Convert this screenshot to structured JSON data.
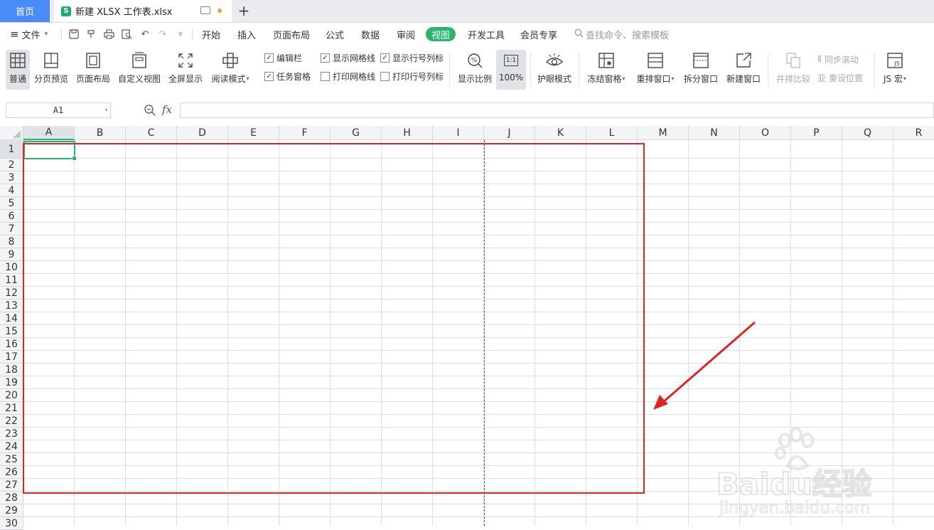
{
  "tabs": {
    "home": "首页",
    "file": "新建 XLSX 工作表.xlsx",
    "file_icon": "S",
    "add": "+"
  },
  "menu": {
    "file": "文件",
    "items": [
      "开始",
      "插入",
      "页面布局",
      "公式",
      "数据",
      "审阅",
      "视图",
      "开发工具",
      "会员专享"
    ],
    "active": "视图",
    "search_placeholder": "查找命令、搜索模板"
  },
  "ribbon": {
    "normal": "普通",
    "page_break_preview": "分页预览",
    "page_layout": "页面布局",
    "custom_view": "自定义视图",
    "fullscreen": "全屏显示",
    "reading_mode": "阅读模式",
    "checkboxes": [
      {
        "label": "编辑栏",
        "checked": true
      },
      {
        "label": "任务窗格",
        "checked": true
      },
      {
        "label": "显示网格线",
        "checked": true
      },
      {
        "label": "打印网格线",
        "checked": false
      },
      {
        "label": "显示行号列标",
        "checked": true
      },
      {
        "label": "打印行号列标",
        "checked": false
      }
    ],
    "zoom_ratio": "显示比例",
    "zoom_100": "100%",
    "zoom_100_icon": "1:1",
    "eye_mode": "护眼模式",
    "freeze_panes": "冻结窗格",
    "arrange_windows": "重排窗口",
    "split_window": "拆分窗口",
    "new_window": "新建窗口",
    "side_by_side": "并排比较",
    "sync_scroll": "同步滚动",
    "reset_position": "重设位置",
    "js_macro": "JS 宏"
  },
  "formula_bar": {
    "name_box": "A1",
    "fx": "fx",
    "value": ""
  },
  "grid": {
    "columns": [
      "A",
      "B",
      "C",
      "D",
      "E",
      "F",
      "G",
      "H",
      "I",
      "J",
      "K",
      "L",
      "M",
      "N",
      "O",
      "P",
      "Q",
      "R"
    ],
    "rows": [
      "1",
      "2",
      "3",
      "4",
      "5",
      "6",
      "7",
      "8",
      "9",
      "10",
      "11",
      "12",
      "13",
      "14",
      "15",
      "16",
      "17",
      "18",
      "19",
      "20",
      "21",
      "22",
      "23",
      "24",
      "25",
      "26",
      "27",
      "28",
      "29",
      "30"
    ],
    "selected_cell": "A1"
  },
  "watermark": {
    "line1": "Baidu经验",
    "line2": "jingyan.baidu.com"
  },
  "colors": {
    "accent_green": "#2bb471",
    "home_tab_blue": "#4a8cf7",
    "highlight_red": "#e02424",
    "grid_line": "#dadde1"
  }
}
